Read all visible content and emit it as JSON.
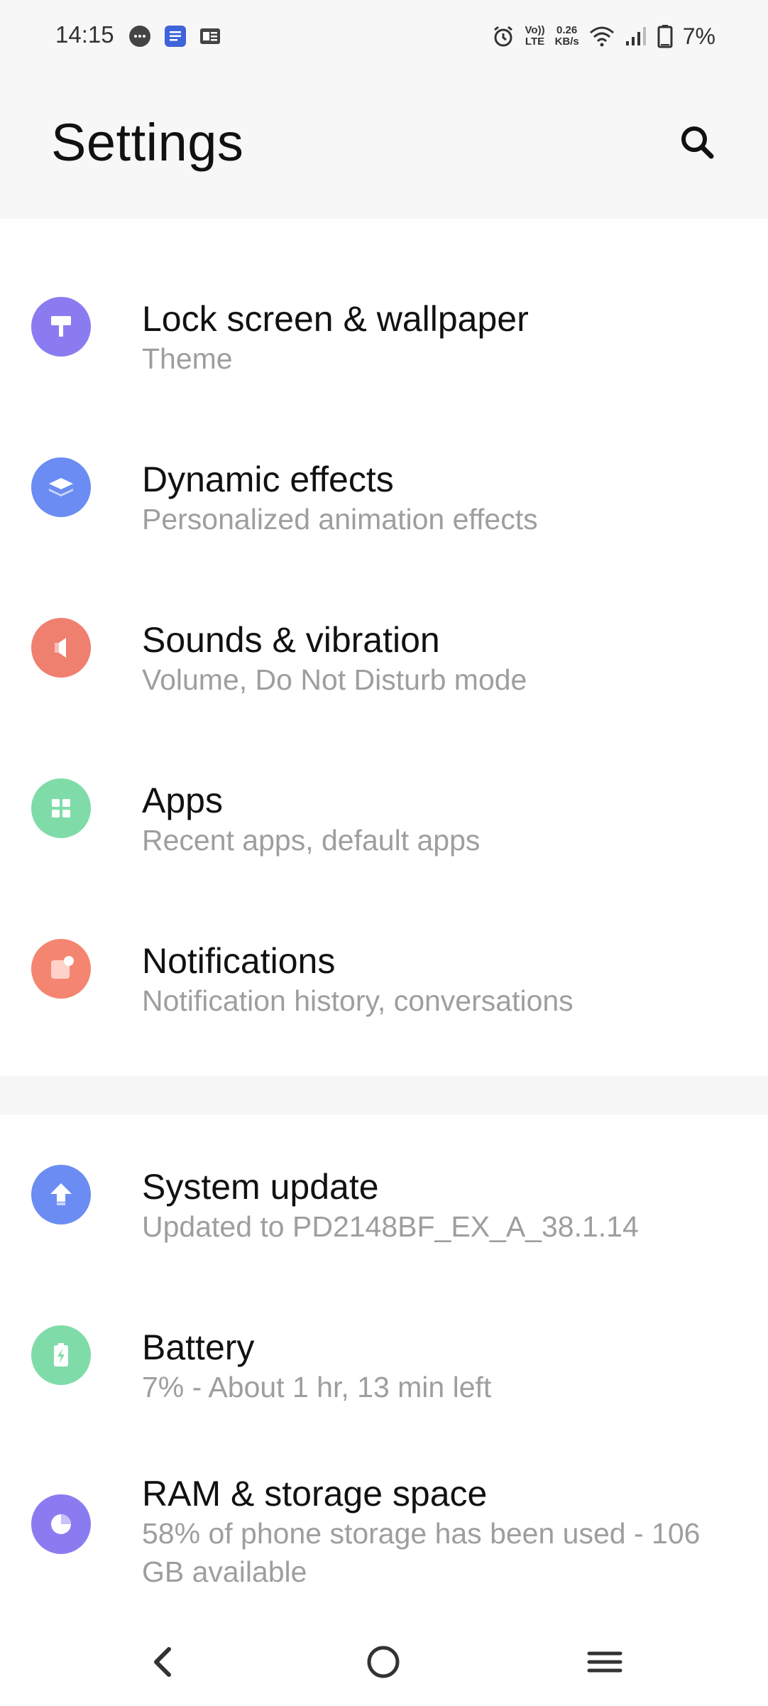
{
  "status_bar": {
    "time": "14:15",
    "notification_icons": [
      "messages-icon",
      "docs-icon",
      "news-icon"
    ],
    "volte_label_top": "Vo))",
    "volte_label_bottom": "LTE",
    "speed_top": "0.26",
    "speed_bottom": "KB/s",
    "battery_percent": "7%"
  },
  "header": {
    "title": "Settings"
  },
  "sections": [
    {
      "items": [
        {
          "title": "Lock screen & wallpaper",
          "subtitle": "Theme",
          "icon": "paint-roller-icon",
          "icon_color": "#8a7cf0"
        },
        {
          "title": "Dynamic effects",
          "subtitle": "Personalized animation effects",
          "icon": "layers-icon",
          "icon_color": "#6b8cf2"
        },
        {
          "title": "Sounds & vibration",
          "subtitle": "Volume, Do Not Disturb mode",
          "icon": "speaker-icon",
          "icon_color": "#ef7f6f"
        },
        {
          "title": "Apps",
          "subtitle": "Recent apps, default apps",
          "icon": "grid-icon",
          "icon_color": "#7fdca8"
        },
        {
          "title": "Notifications",
          "subtitle": "Notification history, conversations",
          "icon": "notification-icon",
          "icon_color": "#f48570"
        }
      ]
    },
    {
      "items": [
        {
          "title": "System update",
          "subtitle": "Updated to PD2148BF_EX_A_38.1.14",
          "icon": "upload-arrow-icon",
          "icon_color": "#6b8cf2"
        },
        {
          "title": "Battery",
          "subtitle": "7% - About 1 hr, 13 min left",
          "icon": "battery-icon",
          "icon_color": "#7fdca8"
        },
        {
          "title": "RAM & storage space",
          "subtitle": "58% of phone storage has been used - 106 GB available",
          "icon": "pie-icon",
          "icon_color": "#8a7cf0"
        }
      ]
    }
  ],
  "nav_bar": {
    "back": "back-icon",
    "home": "home-icon",
    "menu": "menu-icon"
  }
}
